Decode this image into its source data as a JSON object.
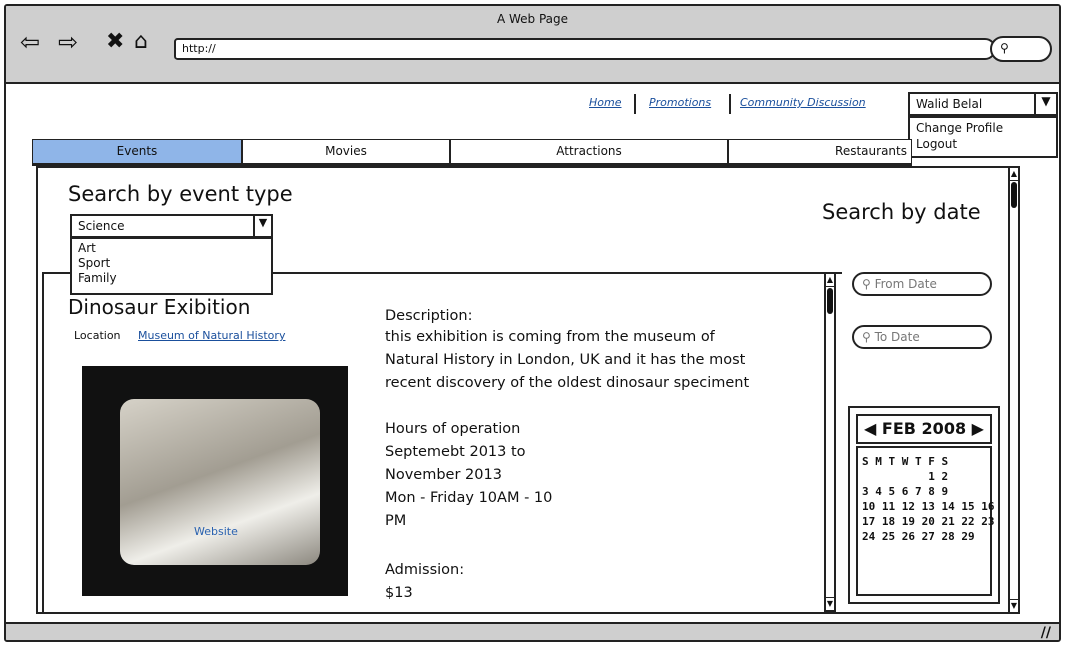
{
  "window": {
    "title": "A Web Page"
  },
  "browser": {
    "url": "http://",
    "back_icon": "back-arrow-icon",
    "forward_icon": "forward-arrow-icon",
    "stop_icon": "close-icon",
    "home_icon": "home-icon",
    "search_icon": "search-icon"
  },
  "top_links": [
    "Home",
    "Promotions",
    "Community Discussion"
  ],
  "user_menu": {
    "selected": "Walid Belal",
    "options": [
      "Change Profile",
      "Logout"
    ]
  },
  "tabs": [
    {
      "label": "Events",
      "active": true
    },
    {
      "label": "Movies",
      "active": false
    },
    {
      "label": "Attractions",
      "active": false
    },
    {
      "label": "Restaurants",
      "active": false
    }
  ],
  "search_event": {
    "title": "Search by event type",
    "selected": "Science",
    "options": [
      "Art",
      "Sport",
      "Family"
    ]
  },
  "search_date": {
    "title": "Search by date",
    "from_placeholder": "From Date",
    "to_placeholder": "To Date"
  },
  "event": {
    "title": "Dinosaur Exibition",
    "location_label": "Location",
    "location_link": "Museum of Natural History",
    "image_label": "Website",
    "description_label": "Description:",
    "description": [
      "this exhibition is coming from the museum of",
      "Natural History in London, UK  and it has the most",
      "recent discovery of the oldest dinosaur  speciment"
    ],
    "hours_label": "Hours of operation",
    "hours": [
      "Septemebt 2013 to",
      "November 2013",
      "Mon - Friday 10AM - 10",
      "PM"
    ],
    "admission_label": "Admission:",
    "admission": "$13"
  },
  "calendar": {
    "month": "FEB 2008",
    "weekdays": "S M T W T F S",
    "rows": [
      "          1 2",
      "3 4 5 6 7 8 9",
      "10 11 12 13 14 15 16",
      "17 18 19 20 21 22 23",
      "24 25 26 27 28 29"
    ]
  }
}
